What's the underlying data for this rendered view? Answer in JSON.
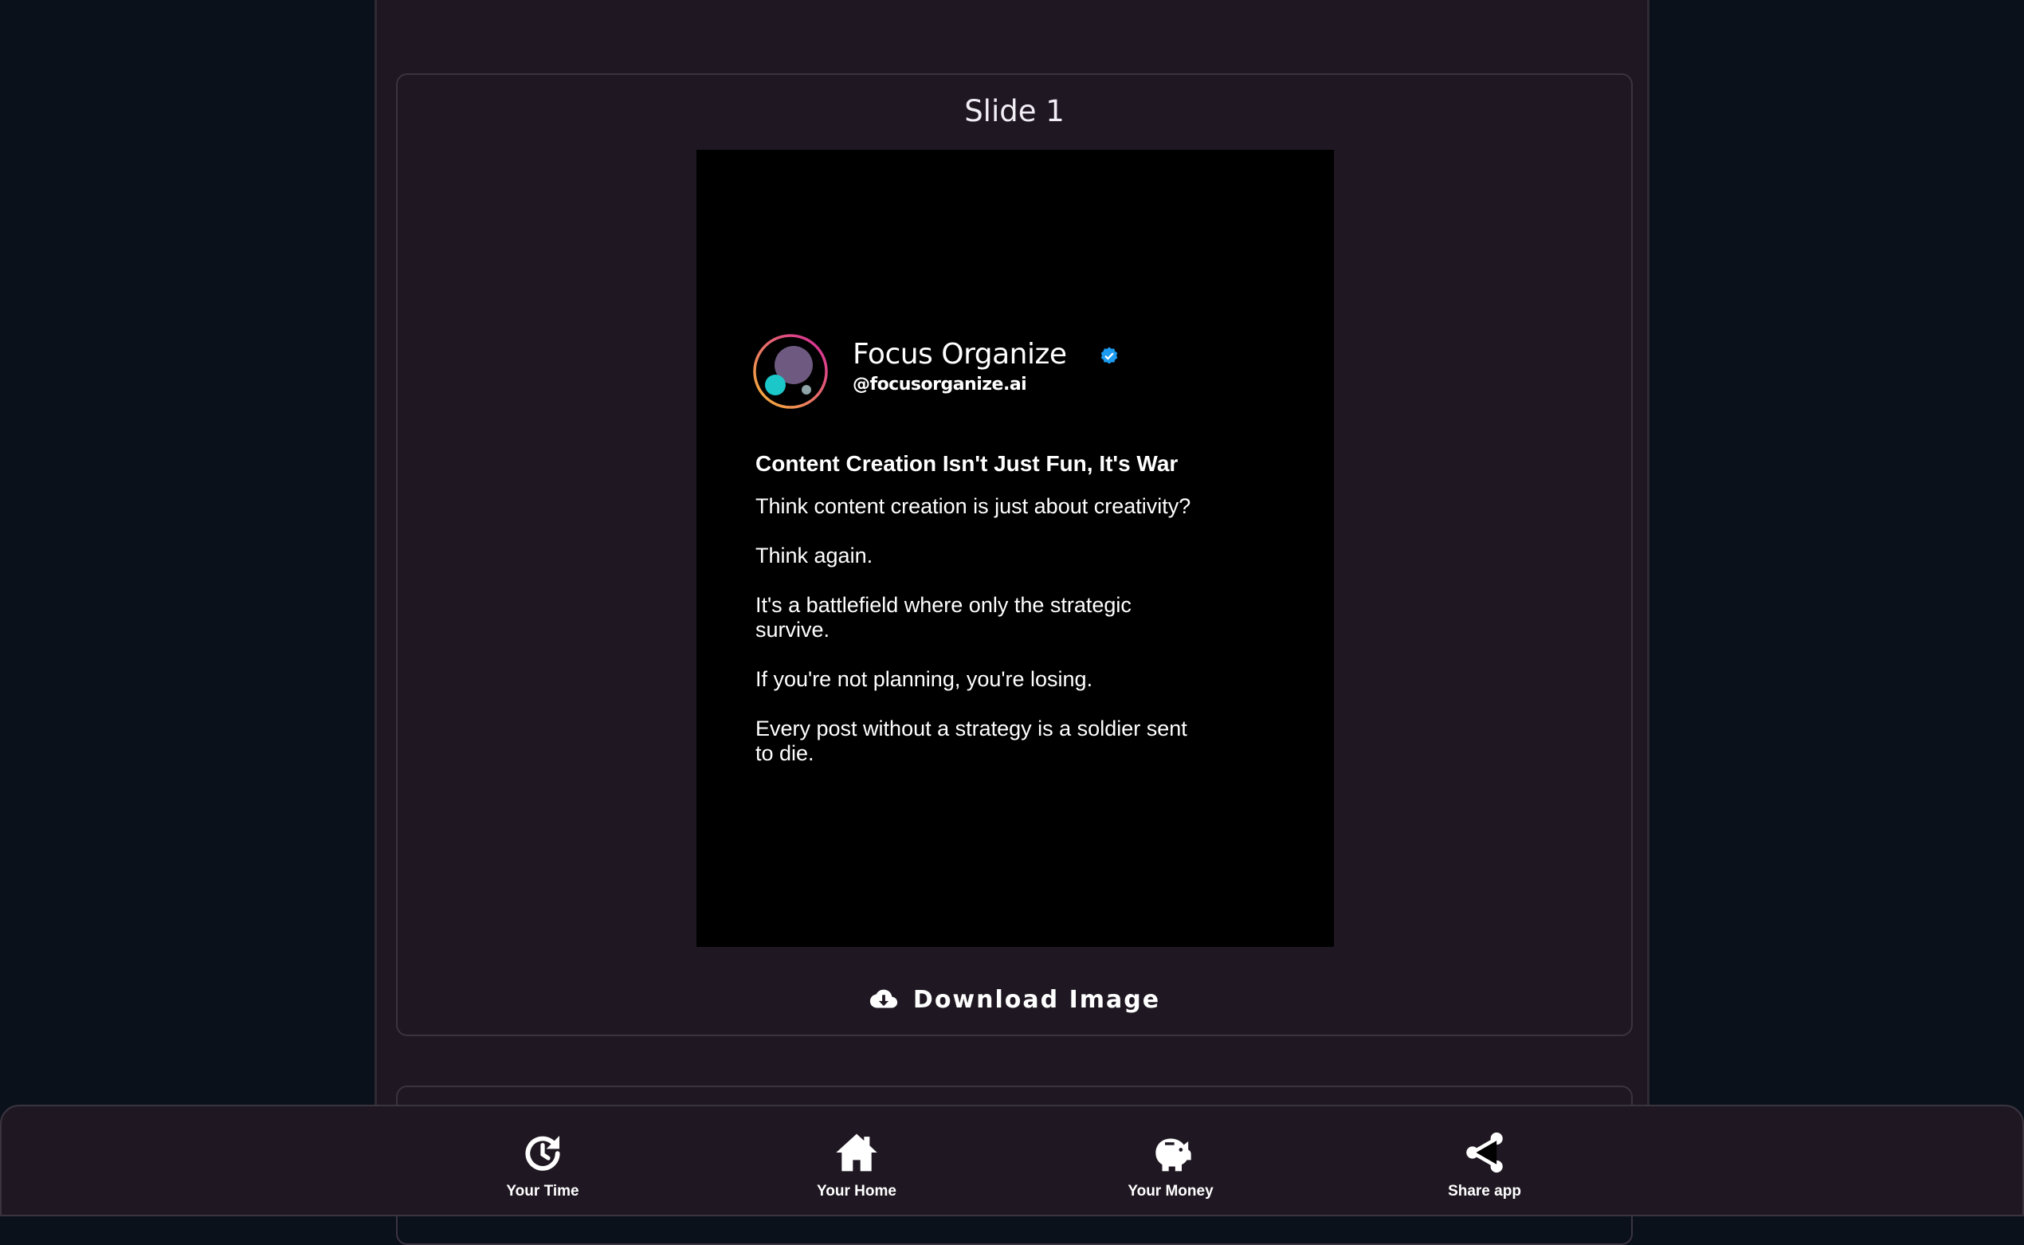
{
  "slide": {
    "title": "Slide 1",
    "profile": {
      "name": "Focus Organize",
      "handle": "@focusorganize.ai"
    },
    "post": {
      "heading": "Content Creation Isn't Just Fun, It's War",
      "paragraphs": [
        "Think content creation is just about creativity?",
        "Think again.",
        "It's a battlefield where only the strategic survive.",
        "If you're not planning, you're losing.",
        "Every post without a strategy is a soldier sent to die."
      ]
    },
    "download_label": "Download Image"
  },
  "nav": [
    {
      "label": "Your Time",
      "icon": "clock-refresh-icon"
    },
    {
      "label": "Your Home",
      "icon": "home-icon"
    },
    {
      "label": "Your Money",
      "icon": "piggy-bank-icon"
    },
    {
      "label": "Share app",
      "icon": "share-icon"
    }
  ],
  "colors": {
    "background": "#0b111a",
    "panel": "#1f1822",
    "border": "#3a3440",
    "verified": "#1d9bf0",
    "avatar_ring_start": "#f7b733",
    "avatar_ring_end": "#d6249f",
    "avatar_teal": "#1cc7c9",
    "avatar_purple": "#6e5a80"
  }
}
